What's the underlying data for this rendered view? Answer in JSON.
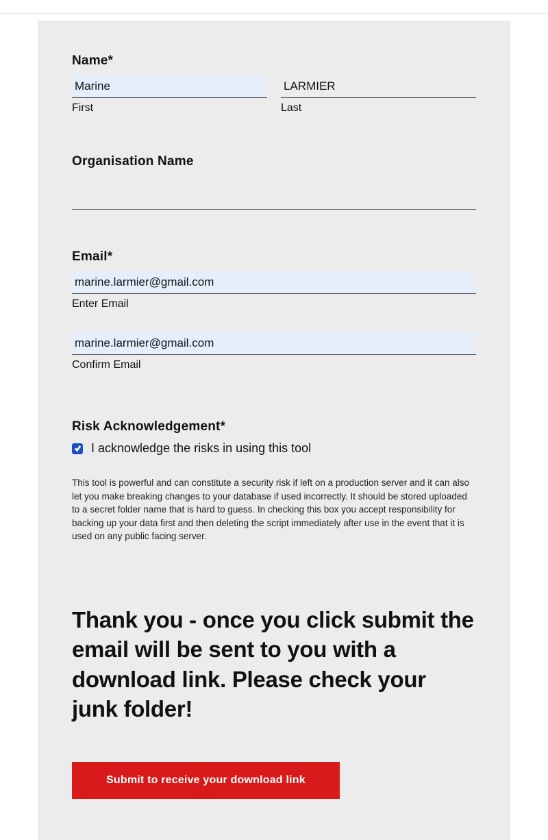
{
  "name": {
    "label": "Name*",
    "first_value": "Marine",
    "first_sub": "First",
    "last_value": "LARMIER",
    "last_sub": "Last"
  },
  "org": {
    "label": "Organisation Name",
    "value": ""
  },
  "email": {
    "label": "Email*",
    "enter_value": "marine.larmier@gmail.com",
    "enter_sub": "Enter Email",
    "confirm_value": "marine.larmier@gmail.com",
    "confirm_sub": "Confirm Email"
  },
  "risk": {
    "label": "Risk Acknowledgement*",
    "checkbox_label": "I acknowledge the risks in using this tool",
    "checked": true,
    "disclaimer": "This tool is powerful and can constitute a security risk if left on a production server and it can also let you make breaking changes to your database if used incorrectly. It should be stored uploaded to a secret folder name that is hard to guess. In checking this box you accept responsibility for backing up your data first and then deleting the script immediately after use in the event that it is used on any public facing server."
  },
  "thankyou": "Thank you - once you click submit the email will be sent to you with a download link. Please check your junk folder!",
  "submit_label": "Submit to receive your download link"
}
